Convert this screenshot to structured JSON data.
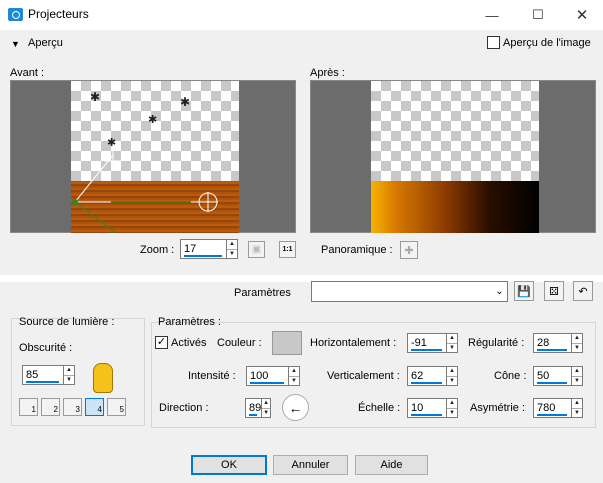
{
  "window": {
    "title": "Projecteurs"
  },
  "preview": {
    "section_label": "Aperçu",
    "preview_checkbox_label": "Aperçu de l'image",
    "before_label": "Avant :",
    "after_label": "Après :"
  },
  "zoom": {
    "label": "Zoom :",
    "value": "17"
  },
  "pan": {
    "label": "Panoramique :"
  },
  "presets": {
    "label": "Paramètres",
    "value": ""
  },
  "light_source": {
    "title": "Source de lumière :",
    "darkness_label": "Obscurité :",
    "darkness_value": "85",
    "light_buttons": [
      "1",
      "2",
      "3",
      "4",
      "5"
    ]
  },
  "params": {
    "title": "Paramètres :",
    "active_label": "Activés",
    "color_label": "Couleur :",
    "color_value": "#c8c8c8",
    "intensity_label": "Intensité :",
    "intensity_value": "100",
    "direction_label": "Direction :",
    "direction_value": "89",
    "horizontal_label": "Horizontalement :",
    "horizontal_value": "-91",
    "vertical_label": "Verticalement :",
    "vertical_value": "62",
    "scale_label": "Échelle :",
    "scale_value": "10",
    "regularity_label": "Régularité :",
    "regularity_value": "28",
    "cone_label": "Cône :",
    "cone_value": "50",
    "asymmetry_label": "Asymétrie :",
    "asymmetry_value": "780"
  },
  "buttons": {
    "ok": "OK",
    "cancel": "Annuler",
    "help": "Aide"
  },
  "colors": {
    "accent": "#0078d7",
    "wood": "#b8580d"
  }
}
